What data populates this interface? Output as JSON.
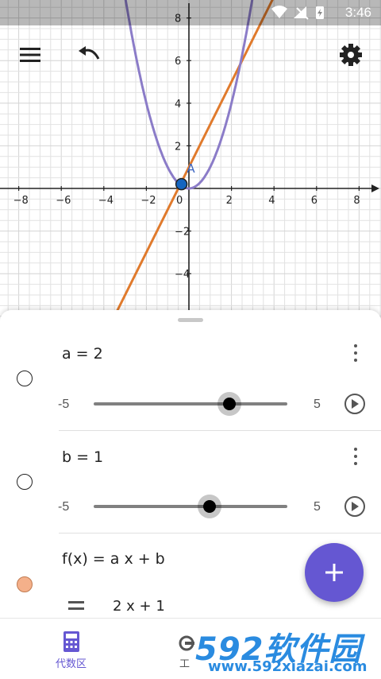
{
  "status_bar": {
    "time": "3:46"
  },
  "graph": {
    "x_ticks": [
      "−8",
      "−6",
      "−4",
      "−2",
      "0",
      "2",
      "4",
      "6",
      "8"
    ],
    "y_ticks": [
      "8",
      "6",
      "4",
      "2",
      "−2",
      "−4"
    ],
    "point_label": "A",
    "colors": {
      "parabola": "#8b7cc8",
      "line": "#e07a2c",
      "point": "#1565c0",
      "axis": "#222222",
      "grid": "#e2e2e2"
    }
  },
  "toolbar": {
    "menu_icon": "menu-icon",
    "undo_icon": "undo-icon",
    "settings_icon": "gear-icon"
  },
  "algebra": {
    "items": [
      {
        "expression": "a = 2",
        "slider_min": "-5",
        "slider_max": "5",
        "slider_value": 2
      },
      {
        "expression": "b = 1",
        "slider_min": "-5",
        "slider_max": "5",
        "slider_value": 1
      },
      {
        "expression": "f(x) = a x + b",
        "result": "2 x + 1",
        "color": "#f4b08a"
      }
    ]
  },
  "fab": {
    "icon": "plus-icon",
    "color": "#6557d2"
  },
  "bottom_nav": {
    "items": [
      {
        "label": "代数区",
        "icon": "calculator-icon"
      },
      {
        "label": "工",
        "icon": "tools-icon"
      }
    ]
  },
  "watermark": {
    "brand": "592软件园",
    "url": "www.592xiazai.com"
  }
}
